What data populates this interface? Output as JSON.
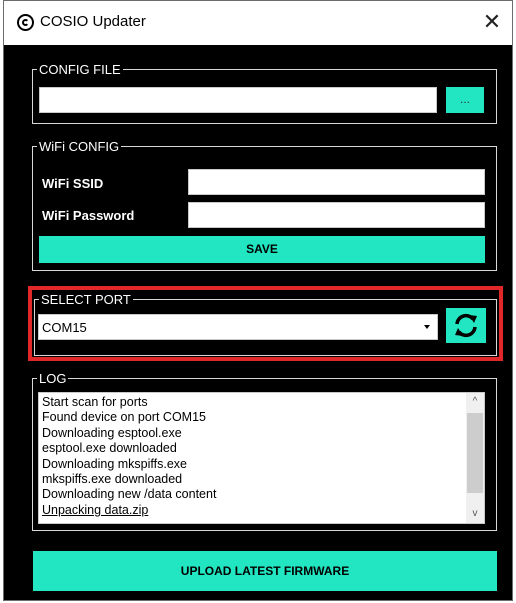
{
  "window": {
    "title": "COSIO Updater",
    "close_glyph": "✕",
    "app_icon": "cosio-logo-icon"
  },
  "config_file": {
    "legend": "CONFIG FILE",
    "path_value": "",
    "browse_label": "..."
  },
  "wifi": {
    "legend": "WiFi CONFIG",
    "ssid_label": "WiFi SSID",
    "ssid_value": "",
    "password_label": "WiFi Password",
    "password_value": "",
    "save_label": "SAVE"
  },
  "port": {
    "legend": "SELECT PORT",
    "selected": "COM15",
    "refresh_icon": "refresh-icon"
  },
  "log": {
    "legend": "LOG",
    "lines": [
      "Start scan for ports",
      "Found device on port COM15",
      "Downloading esptool.exe",
      "esptool.exe downloaded",
      "Downloading mkspiffs.exe",
      "mkspiffs.exe downloaded",
      "Downloading new /data content",
      "Unpacking data.zip"
    ],
    "scroll_up": "^",
    "scroll_down": "v"
  },
  "upload": {
    "label": "UPLOAD LATEST FIRMWARE"
  },
  "colors": {
    "accent": "#21e6c1",
    "background": "#000000",
    "highlight": "#e0282b"
  }
}
